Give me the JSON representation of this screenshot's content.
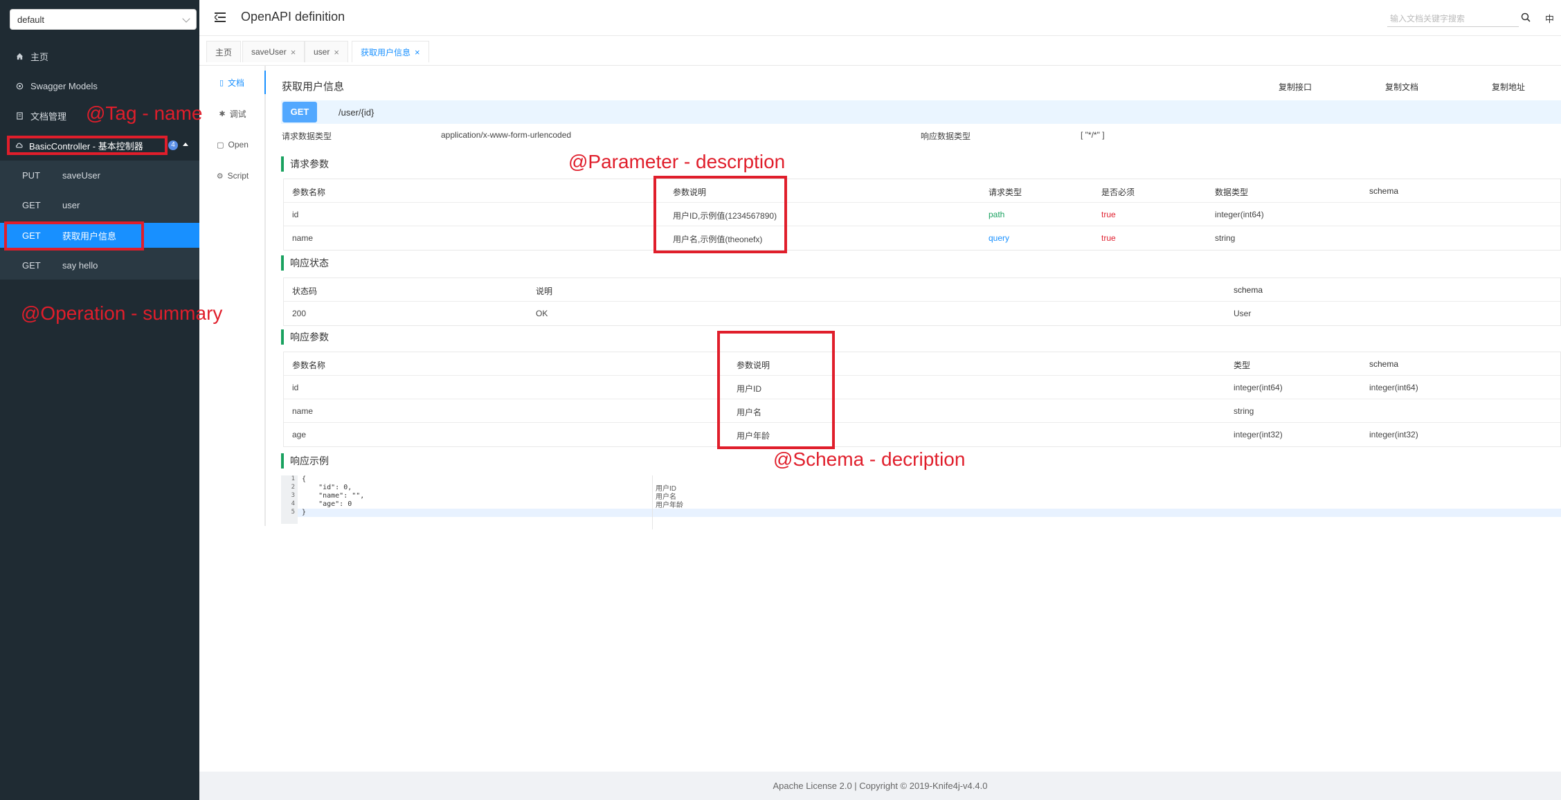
{
  "sidebar": {
    "group_select": "default",
    "items": [
      {
        "label": "主页",
        "icon": "home-icon"
      },
      {
        "label": "Swagger Models",
        "icon": "models-icon"
      },
      {
        "label": "文档管理",
        "icon": "docs-icon"
      }
    ],
    "controller": {
      "label": "BasicController - 基本控制器",
      "count": "4"
    },
    "operations": [
      {
        "method": "PUT",
        "label": "saveUser"
      },
      {
        "method": "GET",
        "label": "user"
      },
      {
        "method": "GET",
        "label": "获取用户信息",
        "active": true
      },
      {
        "method": "GET",
        "label": "say hello"
      }
    ],
    "annotations": {
      "tag": "@Tag - name",
      "operation": "@Operation - summary"
    }
  },
  "header": {
    "title": "OpenAPI definition",
    "search_placeholder": "输入文档关键字搜索",
    "lang": "中"
  },
  "tabs": [
    {
      "label": "主页"
    },
    {
      "label": "saveUser"
    },
    {
      "label": "user"
    },
    {
      "label": "获取用户信息",
      "active": true
    }
  ],
  "subtabs": [
    {
      "label": "文档",
      "active": true
    },
    {
      "label": "调试"
    },
    {
      "label": "Open"
    },
    {
      "label": "Script"
    }
  ],
  "doc": {
    "title": "获取用户信息",
    "copy_api": "复制接口",
    "copy_doc": "复制文档",
    "copy_url": "复制地址",
    "method": "GET",
    "path": "/user/{id}",
    "req_type_label": "请求数据类型",
    "req_type_value": "application/x-www-form-urlencoded",
    "resp_type_label": "响应数据类型",
    "resp_type_value": "[ \"*/*\" ]"
  },
  "request_params": {
    "title": "请求参数",
    "headers": [
      "参数名称",
      "参数说明",
      "请求类型",
      "是否必须",
      "数据类型",
      "schema"
    ],
    "rows": [
      [
        "id",
        "用户ID,示例值(1234567890)",
        "path",
        "true",
        "integer(int64)",
        ""
      ],
      [
        "name",
        "用户名,示例值(theonefx)",
        "query",
        "true",
        "string",
        ""
      ]
    ],
    "annotation": "@Parameter - descrption"
  },
  "response_status": {
    "title": "响应状态",
    "headers": [
      "状态码",
      "说明",
      "schema"
    ],
    "rows": [
      [
        "200",
        "OK",
        "User"
      ]
    ]
  },
  "response_params": {
    "title": "响应参数",
    "headers": [
      "参数名称",
      "参数说明",
      "类型",
      "schema"
    ],
    "rows": [
      [
        "id",
        "用户ID",
        "integer(int64)",
        "integer(int64)"
      ],
      [
        "name",
        "用户名",
        "string",
        ""
      ],
      [
        "age",
        "用户年龄",
        "integer(int32)",
        "integer(int32)"
      ]
    ],
    "annotation": "@Schema - decription"
  },
  "response_example": {
    "title": "响应示例",
    "lines": [
      "{",
      "    \"id\": 0,",
      "    \"name\": \"\",",
      "    \"age\": 0",
      "}"
    ],
    "line_numbers": [
      "1",
      "2",
      "3",
      "4",
      "5"
    ],
    "comments": [
      "用户ID",
      "用户名",
      "用户年龄"
    ]
  },
  "footer": "Apache License 2.0 | Copyright © 2019-Knife4j-v4.4.0"
}
